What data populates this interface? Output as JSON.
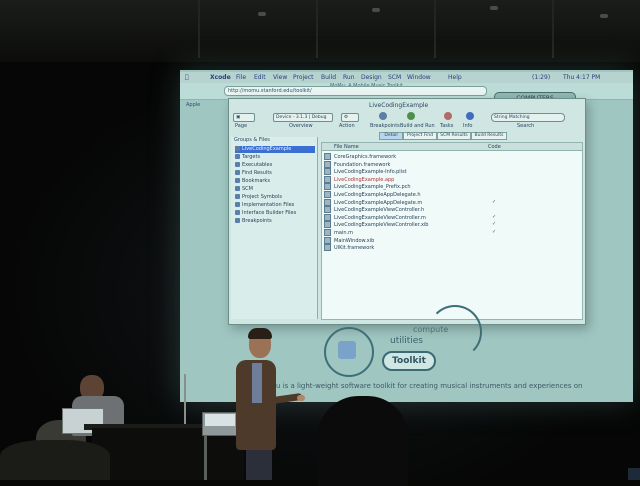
{
  "menubar": {
    "app": "Xcode",
    "items": [
      "File",
      "Edit",
      "View",
      "Project",
      "Build",
      "Run",
      "Design",
      "SCM",
      "Window",
      "Help"
    ],
    "battery": "(1:29)",
    "clock": "Thu 4:17 PM"
  },
  "browser": {
    "window_title": "MoMu: A Mobile Music Toolkit",
    "url": "http://momu.stanford.edu/toolkit/",
    "bookmark": "Apple",
    "button": "COMPUTERS"
  },
  "xcode": {
    "title": "LiveCodingExample",
    "device_selector": "Device - 3.1.3 | Debug",
    "toolbar_labels": [
      "Page",
      "Overview",
      "Action",
      "Breakpoints",
      "Build and Run",
      "Tasks",
      "Info",
      "Search"
    ],
    "search_placeholder": "String Matching",
    "sidebar_header": "Groups & Files",
    "sidebar_items": [
      "LiveCodingExample",
      "Targets",
      "Executables",
      "Find Results",
      "Bookmarks",
      "SCM",
      "Project Symbols",
      "Implementation Files",
      "Interface Builder Files",
      "Breakpoints"
    ],
    "tabs": [
      "Detail",
      "Project Find",
      "SCM Results",
      "Build Results"
    ],
    "file_header": "File Name",
    "code_header": "Code",
    "files": [
      {
        "name": "CoreGraphics.framework",
        "red": false,
        "check": false
      },
      {
        "name": "Foundation.framework",
        "red": false,
        "check": false
      },
      {
        "name": "LiveCodingExample-Info.plist",
        "red": false,
        "check": false
      },
      {
        "name": "LiveCodingExample.app",
        "red": true,
        "check": false
      },
      {
        "name": "LiveCodingExample_Prefix.pch",
        "red": false,
        "check": false
      },
      {
        "name": "LiveCodingExampleAppDelegate.h",
        "red": false,
        "check": false
      },
      {
        "name": "LiveCodingExampleAppDelegate.m",
        "red": false,
        "check": true
      },
      {
        "name": "LiveCodingExampleViewController.h",
        "red": false,
        "check": false
      },
      {
        "name": "LiveCodingExampleViewController.m",
        "red": false,
        "check": true
      },
      {
        "name": "LiveCodingExampleViewController.xib",
        "red": false,
        "check": true
      },
      {
        "name": "main.m",
        "red": false,
        "check": true
      },
      {
        "name": "MainWindow.xib",
        "red": false,
        "check": false
      },
      {
        "name": "UIKit.framework",
        "red": false,
        "check": false
      }
    ]
  },
  "website": {
    "compute": "compute",
    "utilities": "utilities",
    "toolkit": "Toolkit",
    "tagline": "Mu is a light-weight software toolkit for creating musical instruments and experiences on"
  }
}
